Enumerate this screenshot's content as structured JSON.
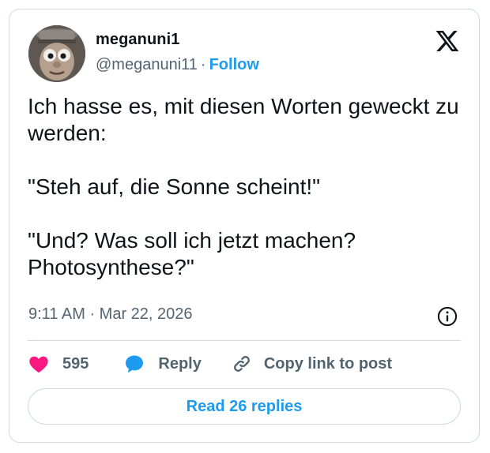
{
  "author": {
    "display_name": "meganuni1",
    "handle": "@meganuni11",
    "separator": "·",
    "follow_label": "Follow"
  },
  "tweet": {
    "text": "Ich hasse es, mit diesen Worten geweckt zu werden:\n\n\"Steh auf, die Sonne scheint!\"\n\n\"Und? Was soll ich jetzt machen? Photosynthese?\"",
    "timestamp": "9:11 AM · Mar 22, 2026"
  },
  "actions": {
    "likes_count": "595",
    "reply_label": "Reply",
    "copy_link_label": "Copy link to post"
  },
  "read_replies_label": "Read 26 replies",
  "icons": {
    "logo": "x-logo-icon",
    "info": "info-icon",
    "like": "heart-icon",
    "reply": "speech-bubble-icon",
    "copy": "link-icon"
  },
  "colors": {
    "accent": "#1d9bf0",
    "like": "#f91880",
    "text": "#0f1419",
    "secondary": "#536471",
    "border": "#cfd9de"
  }
}
